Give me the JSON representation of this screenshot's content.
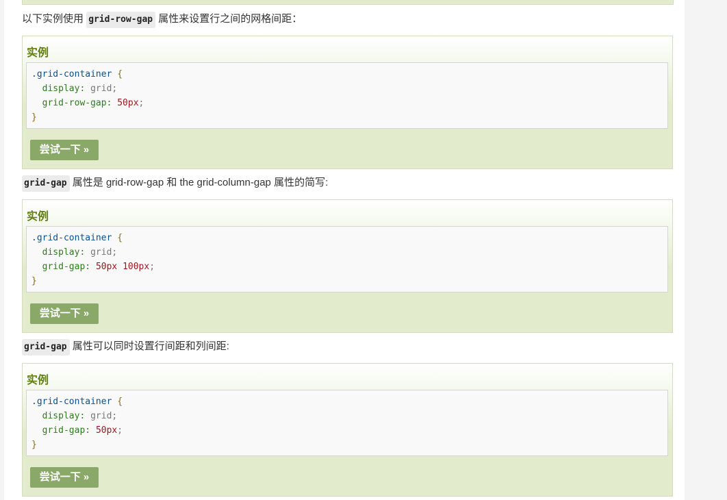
{
  "paragraphs": {
    "p1": {
      "prefix": "以下实例使用",
      "code": "grid-row-gap",
      "suffix": "属性来设置行之间的网格间距："
    },
    "p2": {
      "code": "grid-gap",
      "suffix": "属性是 grid-row-gap 和 the grid-column-gap 属性的简写:"
    },
    "p3": {
      "code": "grid-gap",
      "suffix": "属性可以同时设置行间距和列间距:"
    }
  },
  "examples": [
    {
      "title": "实例",
      "selector": ".grid-container",
      "open_brace": "{",
      "close_brace": "}",
      "line1": {
        "prop": "display",
        "value": "grid"
      },
      "line2": {
        "prop": "grid-row-gap",
        "value": "50px"
      },
      "button": "尝试一下 »"
    },
    {
      "title": "实例",
      "selector": ".grid-container",
      "open_brace": "{",
      "close_brace": "}",
      "line1": {
        "prop": "display",
        "value": "grid"
      },
      "line2": {
        "prop": "grid-gap",
        "value": "50px 100px"
      },
      "button": "尝试一下 »"
    },
    {
      "title": "实例",
      "selector": ".grid-container",
      "open_brace": "{",
      "close_brace": "}",
      "line1": {
        "prop": "display",
        "value": "grid"
      },
      "line2": {
        "prop": "grid-gap",
        "value": "50px"
      },
      "button": "尝试一下 »"
    }
  ],
  "colors": {
    "example_bg": "#e2eccc",
    "title_green": "#617f10",
    "button_bg": "#8aa868"
  }
}
